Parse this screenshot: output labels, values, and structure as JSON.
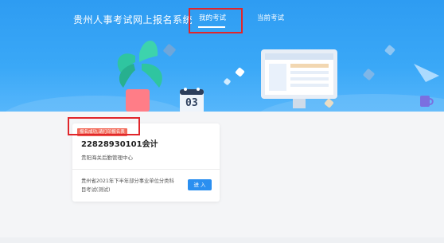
{
  "header": {
    "site_title": "贵州人事考试网上报名系统",
    "tabs": [
      {
        "label": "我的考试",
        "active": true
      },
      {
        "label": "当前考试",
        "active": false
      }
    ]
  },
  "illustration": {
    "calendar_number": "03"
  },
  "exam_card": {
    "status_badge": "报名成功,请打印报名表",
    "exam_code": "22828930101会计",
    "organization": "贵阳海关后勤管理中心",
    "exam_name": "贵州省2021年下半年部分事业单位分类科目考试(测试)",
    "enter_label": "进 入"
  },
  "colors": {
    "banner": "#3aa8f7",
    "badge": "#f26b5b",
    "enter_button": "#2b8ff0",
    "highlight_outline": "#e0262b"
  }
}
